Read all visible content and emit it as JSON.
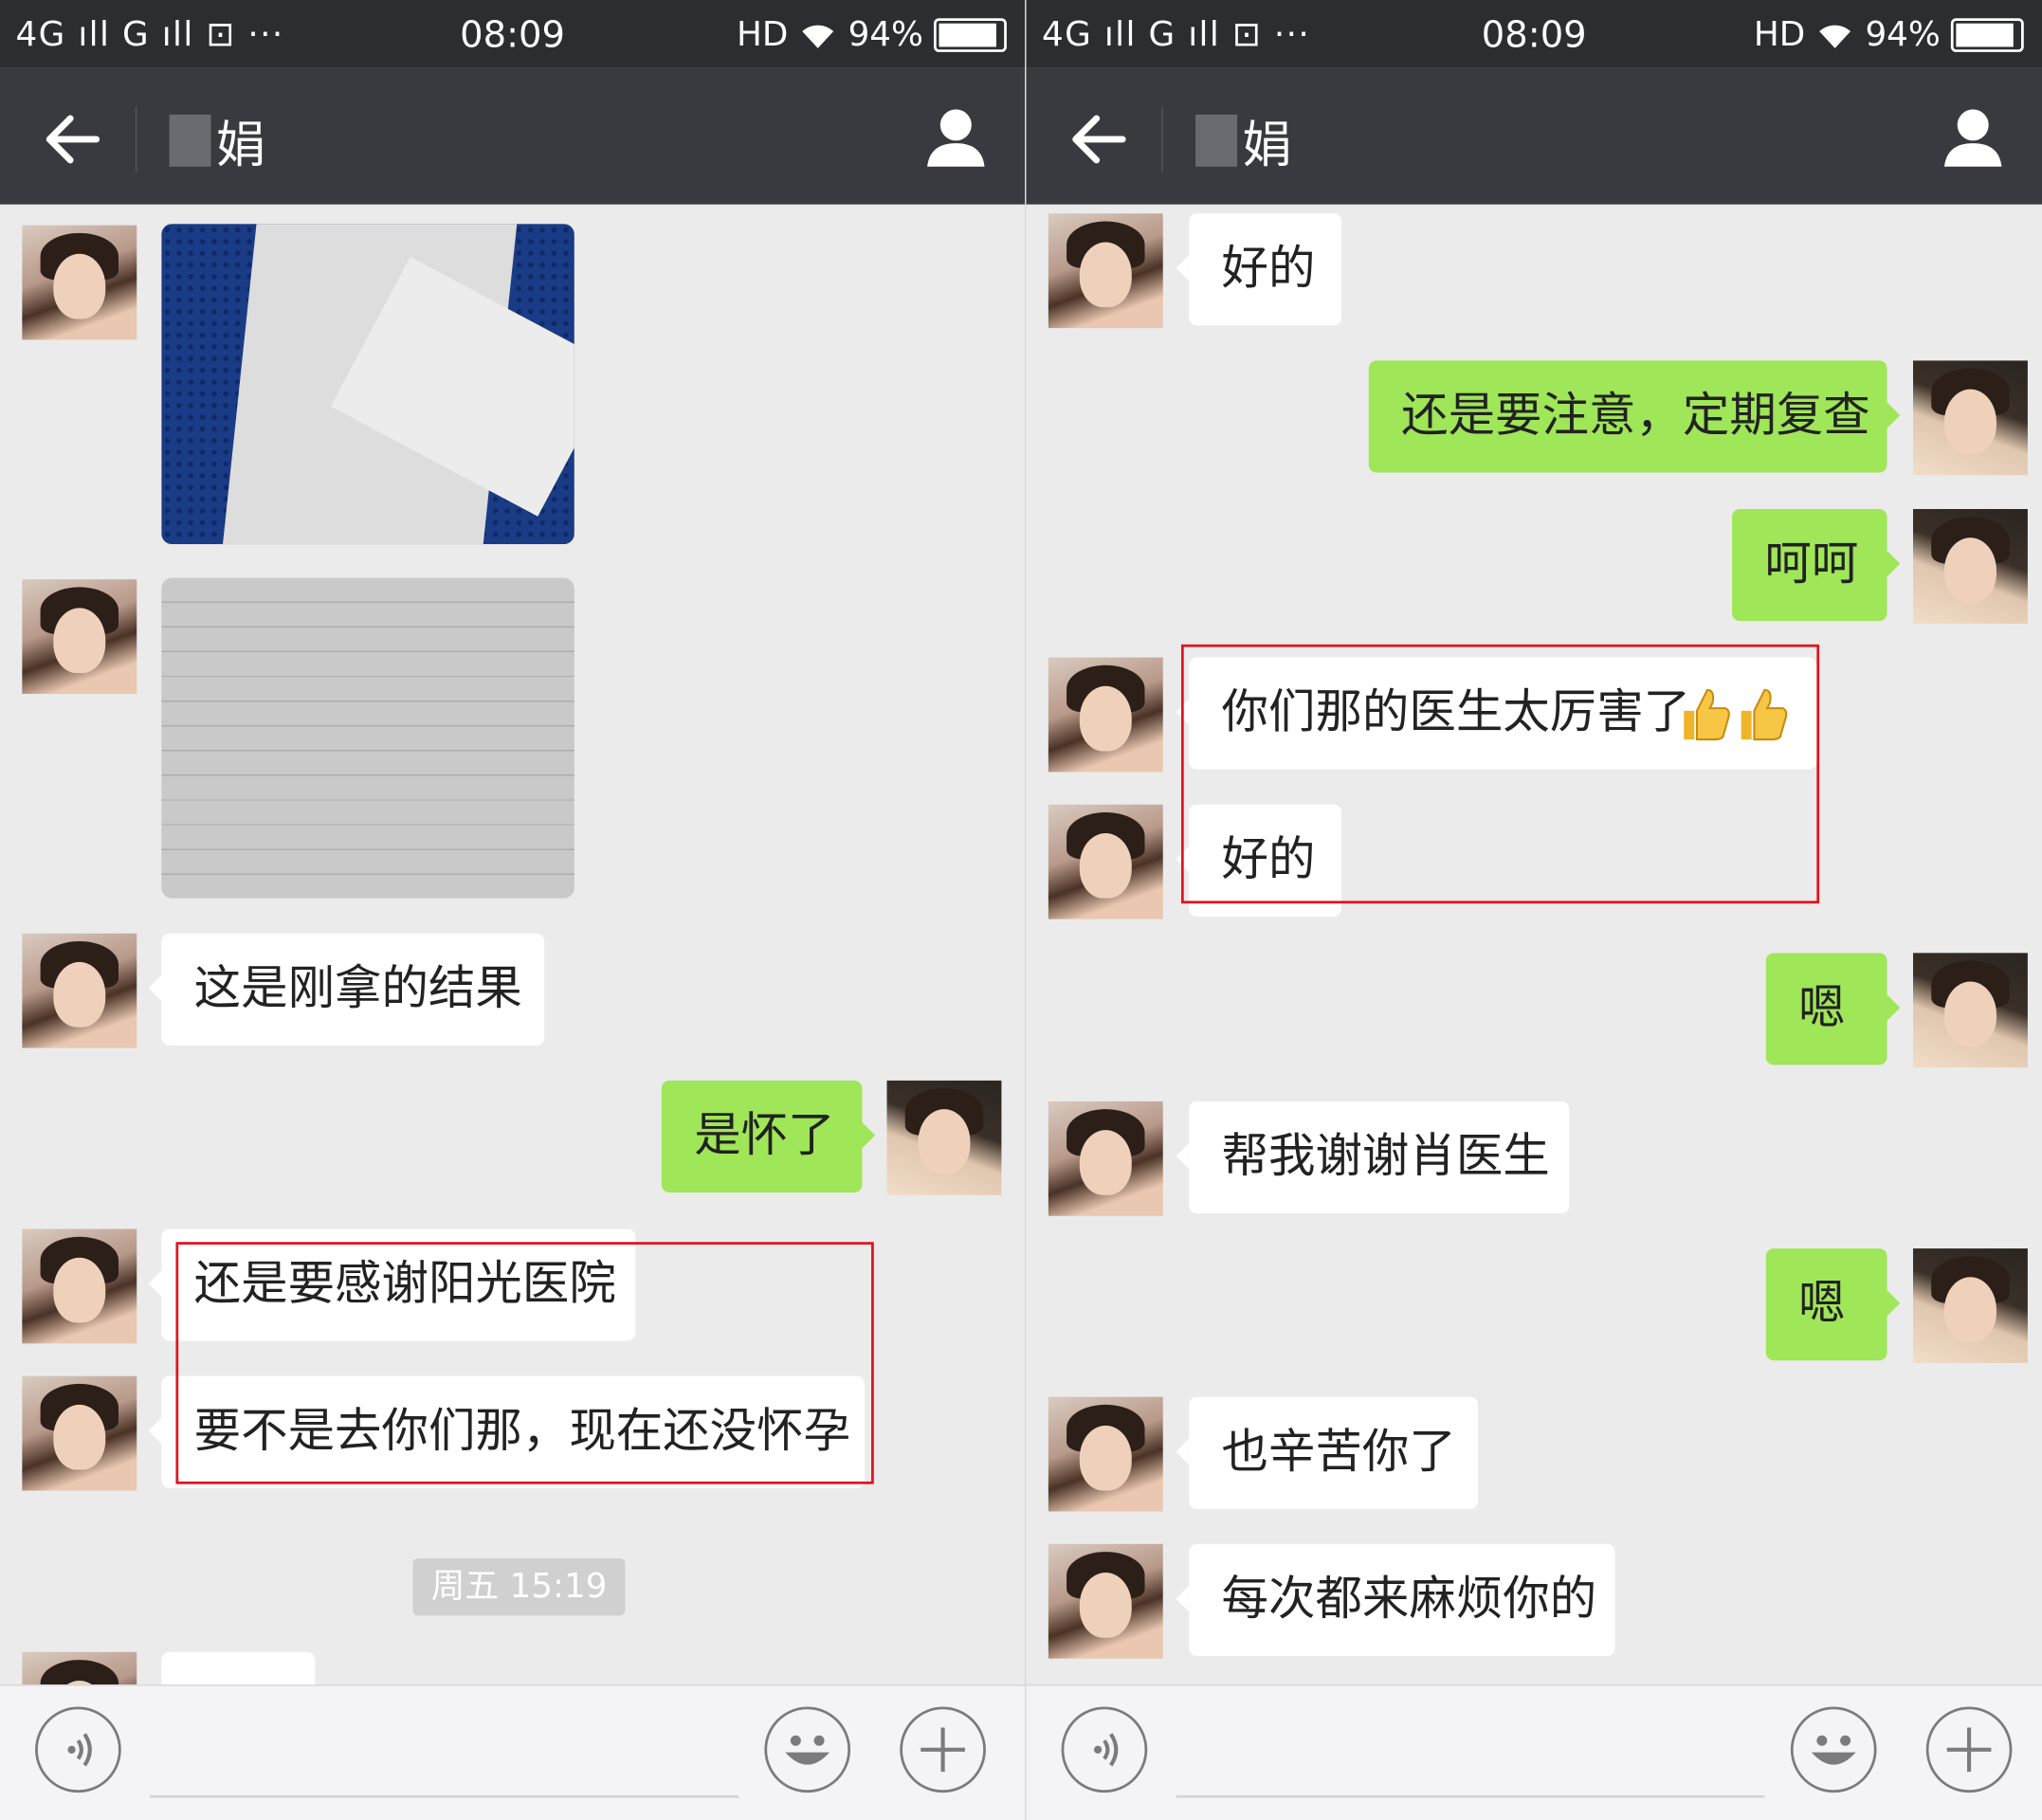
{
  "statusbar": {
    "left": "4G ıll G ıll ⊡ ···",
    "time": "08:09",
    "hd": "HD",
    "battery": "94%"
  },
  "header": {
    "title_suffix": "娟"
  },
  "left": {
    "messages": [
      {
        "from": "her",
        "type": "image",
        "desc": "document photo"
      },
      {
        "from": "her",
        "type": "image",
        "desc": "document photo"
      },
      {
        "from": "her",
        "text": "这是刚拿的结果"
      },
      {
        "from": "me",
        "text": "是怀了"
      },
      {
        "from": "her",
        "text": "还是要感谢阳光医院"
      },
      {
        "from": "her",
        "text": "要不是去你们那，现在还没怀孕"
      }
    ],
    "timestamp": "周五 15:19"
  },
  "right": {
    "messages": [
      {
        "from": "her",
        "text": "好的"
      },
      {
        "from": "me",
        "text": "还是要注意，定期复查"
      },
      {
        "from": "me",
        "text": "呵呵"
      },
      {
        "from": "her",
        "text": "你们那的医生太厉害了"
      },
      {
        "from": "her",
        "text": "好的"
      },
      {
        "from": "me",
        "text": "嗯"
      },
      {
        "from": "her",
        "text": "帮我谢谢肖医生"
      },
      {
        "from": "me",
        "text": "嗯"
      },
      {
        "from": "her",
        "text": "也辛苦你了"
      },
      {
        "from": "her",
        "text": "每次都来麻烦你的"
      }
    ]
  },
  "colors": {
    "statusbar": "#2c2d31",
    "navbar": "#393a3f",
    "chat_bg": "#ebebeb",
    "bubble_out": "#9fe658",
    "bubble_in": "#ffffff",
    "highlight_box": "#e0141e"
  },
  "icons": [
    "back-arrow-icon",
    "person-icon",
    "voice-icon",
    "emoji-icon",
    "plus-icon",
    "thumbs-up-icon",
    "wifi-icon",
    "battery-icon"
  ]
}
